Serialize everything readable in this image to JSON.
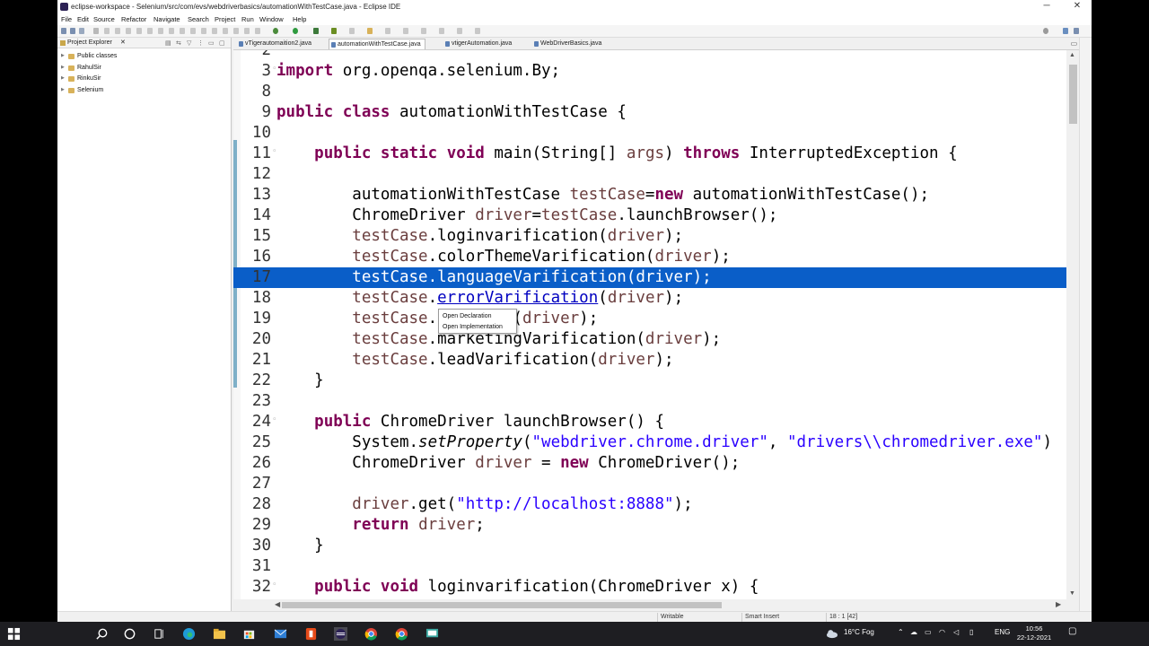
{
  "window": {
    "title": "eclipse-workspace - Selenium/src/com/evs/webdriverbasics/automationWithTestCase.java - Eclipse IDE",
    "minimize": "─",
    "maximize": "❐",
    "close": "✕"
  },
  "menu": [
    "File",
    "Edit",
    "Source",
    "Refactor",
    "Navigate",
    "Search",
    "Project",
    "Run",
    "Window",
    "Help"
  ],
  "explorer": {
    "title": "Project Explorer",
    "close": "✕",
    "items": [
      "Public classes",
      "RahulSir",
      "RinkuSir",
      "Selenium"
    ]
  },
  "tabs": [
    {
      "label": "vTigerautomaition2.java",
      "active": false
    },
    {
      "label": "automationWithTestCase.java",
      "active": true
    },
    {
      "label": "vtigerAutomation.java",
      "active": false
    },
    {
      "label": "WebDriverBasics.java",
      "active": false
    }
  ],
  "editor": {
    "selected_line": 17,
    "lines": [
      {
        "n": "2",
        "code": ""
      },
      {
        "n": "3",
        "code": "import org.openqa.selenium.By;"
      },
      {
        "n": "8",
        "code": ""
      },
      {
        "n": "9",
        "code": "public class automationWithTestCase {"
      },
      {
        "n": "10",
        "code": ""
      },
      {
        "n": "11",
        "code": "    public static void main(String[] args) throws InterruptedException {"
      },
      {
        "n": "12",
        "code": ""
      },
      {
        "n": "13",
        "code": "        automationWithTestCase testCase=new automationWithTestCase();"
      },
      {
        "n": "14",
        "code": "        ChromeDriver driver=testCase.launchBrowser();"
      },
      {
        "n": "15",
        "code": "        testCase.loginvarification(driver);"
      },
      {
        "n": "16",
        "code": "        testCase.colorThemeVarification(driver);"
      },
      {
        "n": "17",
        "code": "        testCase.languageVarification(driver);"
      },
      {
        "n": "18",
        "code": "        testCase.errorVarification(driver);"
      },
      {
        "n": "19",
        "code": "        testCase.        (driver);"
      },
      {
        "n": "20",
        "code": "        testCase.marketingVarification(driver);"
      },
      {
        "n": "21",
        "code": "        testCase.leadVarification(driver);"
      },
      {
        "n": "22",
        "code": "    }"
      },
      {
        "n": "23",
        "code": ""
      },
      {
        "n": "24",
        "code": "    public ChromeDriver launchBrowser() {"
      },
      {
        "n": "25",
        "code": "        System.setProperty(\"webdriver.chrome.driver\", \"drivers\\\\chromedriver.exe\")"
      },
      {
        "n": "26",
        "code": "        ChromeDriver driver = new ChromeDriver();"
      },
      {
        "n": "27",
        "code": ""
      },
      {
        "n": "28",
        "code": "        driver.get(\"http://localhost:8888\");"
      },
      {
        "n": "29",
        "code": "        return driver;"
      },
      {
        "n": "30",
        "code": "    }"
      },
      {
        "n": "31",
        "code": ""
      },
      {
        "n": "32",
        "code": "    public void loginvarification(ChromeDriver x) {"
      }
    ]
  },
  "popup": {
    "items": [
      "Open Declaration",
      "Open Implementation"
    ]
  },
  "status": {
    "writable": "Writable",
    "insert_mode": "Smart Insert",
    "position": "18 : 1 [42]"
  },
  "taskbar": {
    "weather": "16°C  Fog",
    "language": "ENG",
    "time": "10:56",
    "date": "22-12-2021"
  },
  "colors": {
    "keyword": "#7f0055",
    "variable": "#6a3e3e",
    "string": "#2a00ff",
    "selection": "#0a5ec8"
  }
}
